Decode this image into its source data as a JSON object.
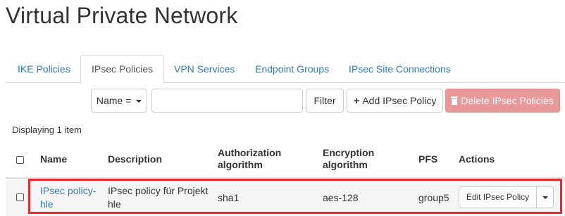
{
  "page": {
    "title": "Virtual Private Network"
  },
  "tabs": [
    {
      "label": "IKE Policies",
      "active": false
    },
    {
      "label": "IPsec Policies",
      "active": true
    },
    {
      "label": "VPN Services",
      "active": false
    },
    {
      "label": "Endpoint Groups",
      "active": false
    },
    {
      "label": "IPsec Site Connections",
      "active": false
    }
  ],
  "toolbar": {
    "filter_field_label": "Name =",
    "filter_value": "",
    "filter_button": "Filter",
    "add_button": "Add IPsec Policy",
    "delete_button": "Delete IPsec Policies"
  },
  "table": {
    "count_text": "Displaying 1 item",
    "headers": {
      "name": "Name",
      "description": "Description",
      "auth_line1": "Authorization",
      "auth_line2": "algorithm",
      "enc_line1": "Encryption",
      "enc_line2": "algorithm",
      "pfs": "PFS",
      "actions": "Actions"
    },
    "rows": [
      {
        "name_line1": "IPsec policy-",
        "name_line2": "hle",
        "description_line1": "IPsec policy für Projekt",
        "description_line2": "hle",
        "auth_algorithm": "sha1",
        "encryption_algorithm": "aes-128",
        "pfs": "group5",
        "action_label": "Edit IPsec Policy"
      }
    ]
  },
  "colors": {
    "link": "#337ab7",
    "danger_disabled": "#e8999a",
    "highlight_border": "#e02d2d"
  }
}
